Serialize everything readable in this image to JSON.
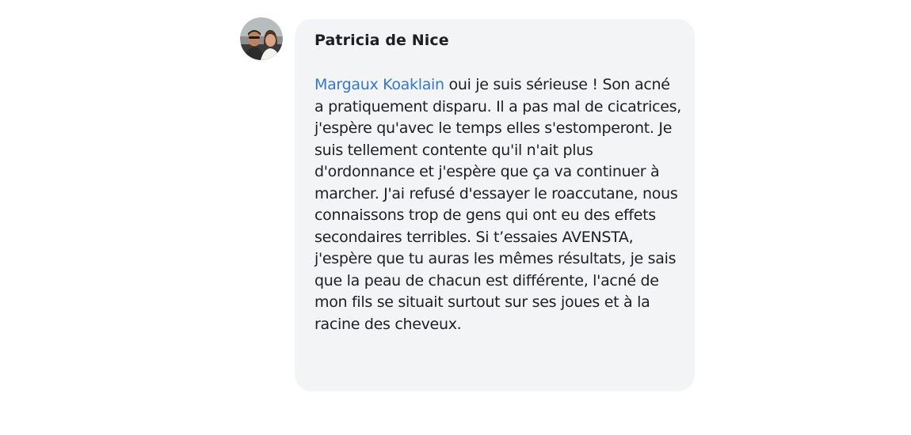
{
  "comment": {
    "author": "Patricia de Nice",
    "mention": "Margaux Koaklain",
    "text": " oui je suis sérieuse ! Son acné a pratiquement disparu. Il a pas mal de cicatrices, j'espère qu'avec le temps elles s'estomperont. Je suis tellement contente qu'il n'ait plus d'ordonnance et j'espère que ça va continuer à marcher. J'ai refusé d'essayer le roaccutane, nous connaissons trop de gens qui ont eu des effets secondaires terribles. Si t’essaies AVENSTA, j'espère que tu auras les mêmes résultats, je sais que la peau de chacun est différente, l'acné de mon fils se situait surtout sur ses joues et à la racine des cheveux."
  },
  "colors": {
    "bubble_bg": "#f3f4f6",
    "mention": "#3578c8",
    "text": "#1c1e21"
  }
}
